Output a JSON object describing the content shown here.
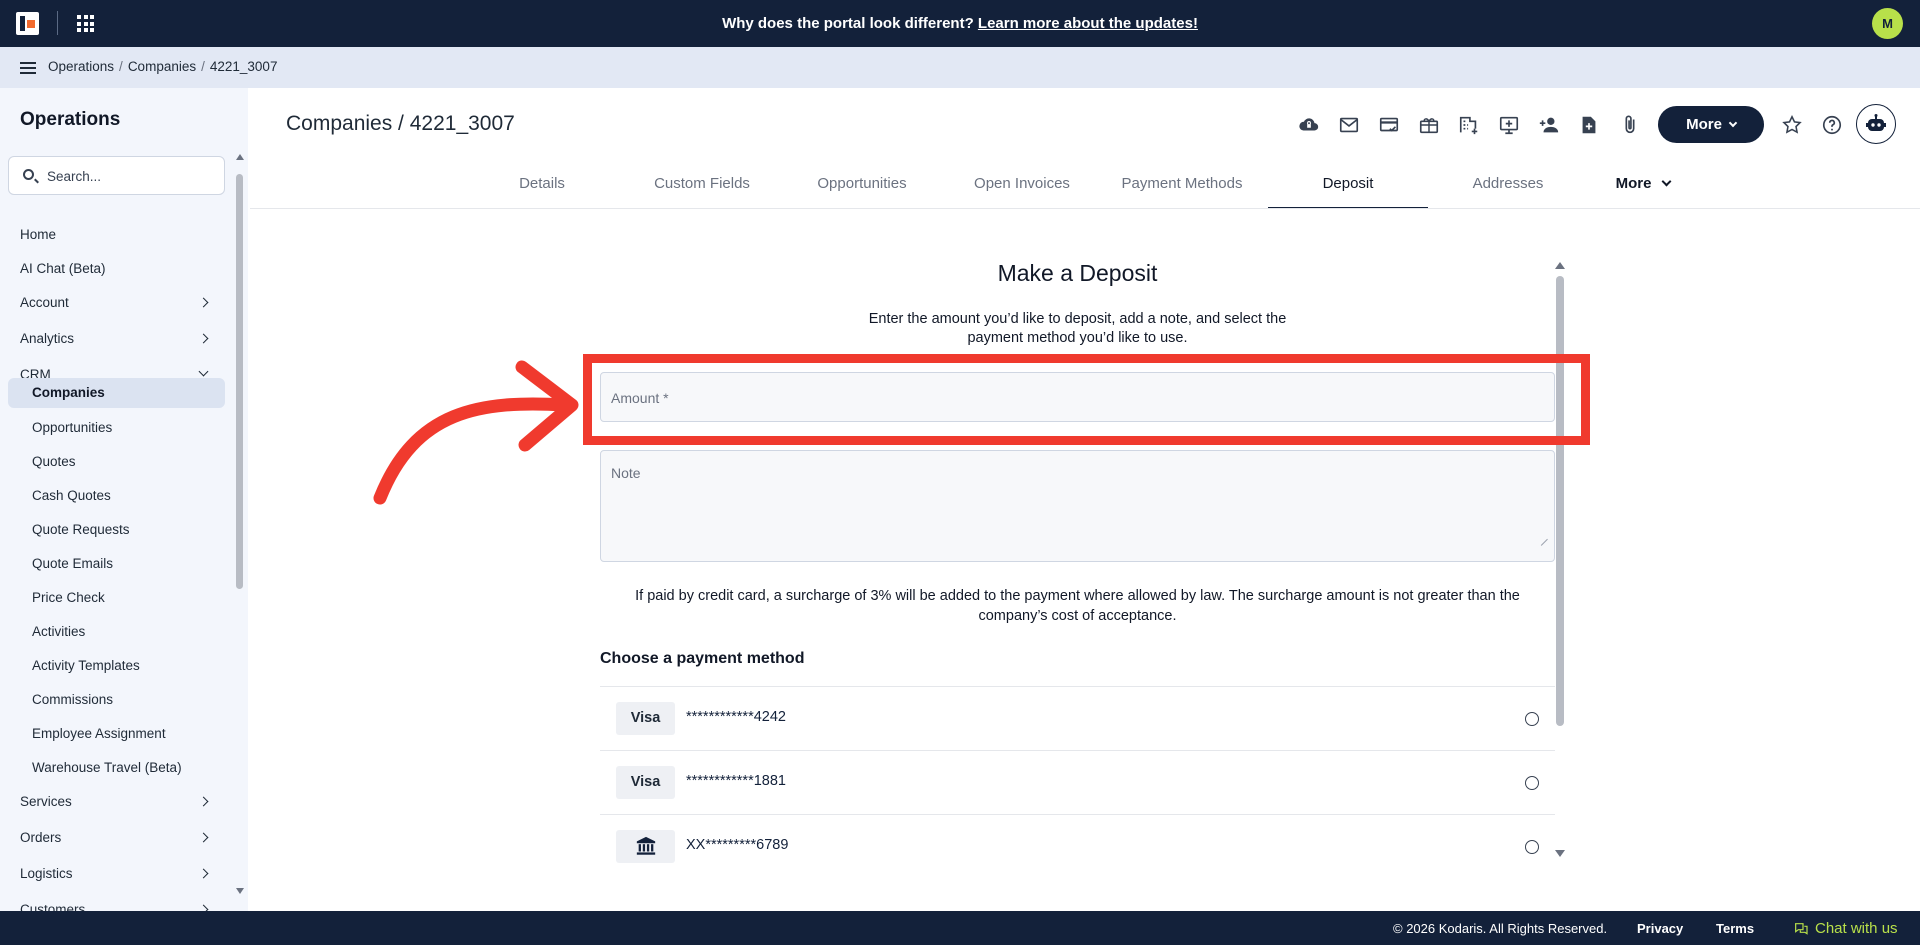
{
  "topbar": {
    "announcement_text": "Why does the portal look different? ",
    "announcement_link": "Learn more about the updates!",
    "user_initial": "M"
  },
  "breadcrumb": {
    "items": [
      "Operations",
      "Companies",
      "4221_3007"
    ]
  },
  "sidebar": {
    "title": "Operations",
    "search_placeholder": "Search...",
    "items": [
      {
        "label": "Home"
      },
      {
        "label": "AI Chat (Beta)"
      },
      {
        "label": "Account"
      },
      {
        "label": "Analytics"
      },
      {
        "label": "CRM"
      },
      {
        "label": "Companies"
      },
      {
        "label": "Opportunities"
      },
      {
        "label": "Quotes"
      },
      {
        "label": "Cash Quotes"
      },
      {
        "label": "Quote Requests"
      },
      {
        "label": "Quote Emails"
      },
      {
        "label": "Price Check"
      },
      {
        "label": "Activities"
      },
      {
        "label": "Activity Templates"
      },
      {
        "label": "Commissions"
      },
      {
        "label": "Employee Assignment"
      },
      {
        "label": "Warehouse Travel (Beta)"
      },
      {
        "label": "Services"
      },
      {
        "label": "Orders"
      },
      {
        "label": "Logistics"
      },
      {
        "label": "Customers"
      }
    ]
  },
  "header": {
    "title": "Companies / 4221_3007",
    "more_label": "More",
    "toolbar_icons": [
      "cloud-lock-icon",
      "mail-icon",
      "card-check-icon",
      "gift-card-icon",
      "building-add-icon",
      "add-to-screen-icon",
      "add-person-icon",
      "add-document-icon",
      "attachment-icon",
      "star-icon",
      "help-icon",
      "bot-icon"
    ]
  },
  "tabs": [
    {
      "label": "Details"
    },
    {
      "label": "Custom Fields"
    },
    {
      "label": "Opportunities"
    },
    {
      "label": "Open Invoices"
    },
    {
      "label": "Payment Methods"
    },
    {
      "label": "Deposit"
    },
    {
      "label": "Addresses"
    },
    {
      "label": "More"
    }
  ],
  "deposit": {
    "title": "Make a Deposit",
    "description": "Enter the amount you’d like to deposit, add a note, and select the payment method you’d like to use.",
    "amount_placeholder": "Amount *",
    "amount_value": "",
    "note_placeholder": "Note",
    "note_value": "",
    "surcharge_text": "If paid by credit card, a surcharge of 3% will be added to the payment where allowed by law. The surcharge amount is not greater than the company’s cost of acceptance.",
    "payment_heading": "Choose a payment method",
    "payment_methods": [
      {
        "type": "Visa",
        "number": "************4242",
        "icon": "card-text"
      },
      {
        "type": "Visa",
        "number": "************1881",
        "icon": "card-text"
      },
      {
        "type": "",
        "number": "XX*********6789",
        "icon": "bank-icon"
      }
    ]
  },
  "annotation": {
    "color": "#f03a2e"
  },
  "footer": {
    "copyright": "© 2026 Kodaris. All Rights Reserved.",
    "privacy": "Privacy",
    "terms": "Terms",
    "chat": "Chat with us"
  },
  "colors": {
    "navy": "#13213a",
    "accent_green": "#b8e04a",
    "sidebar_bg": "#f3f6fc",
    "crumb_bg": "#e2e8f4"
  }
}
